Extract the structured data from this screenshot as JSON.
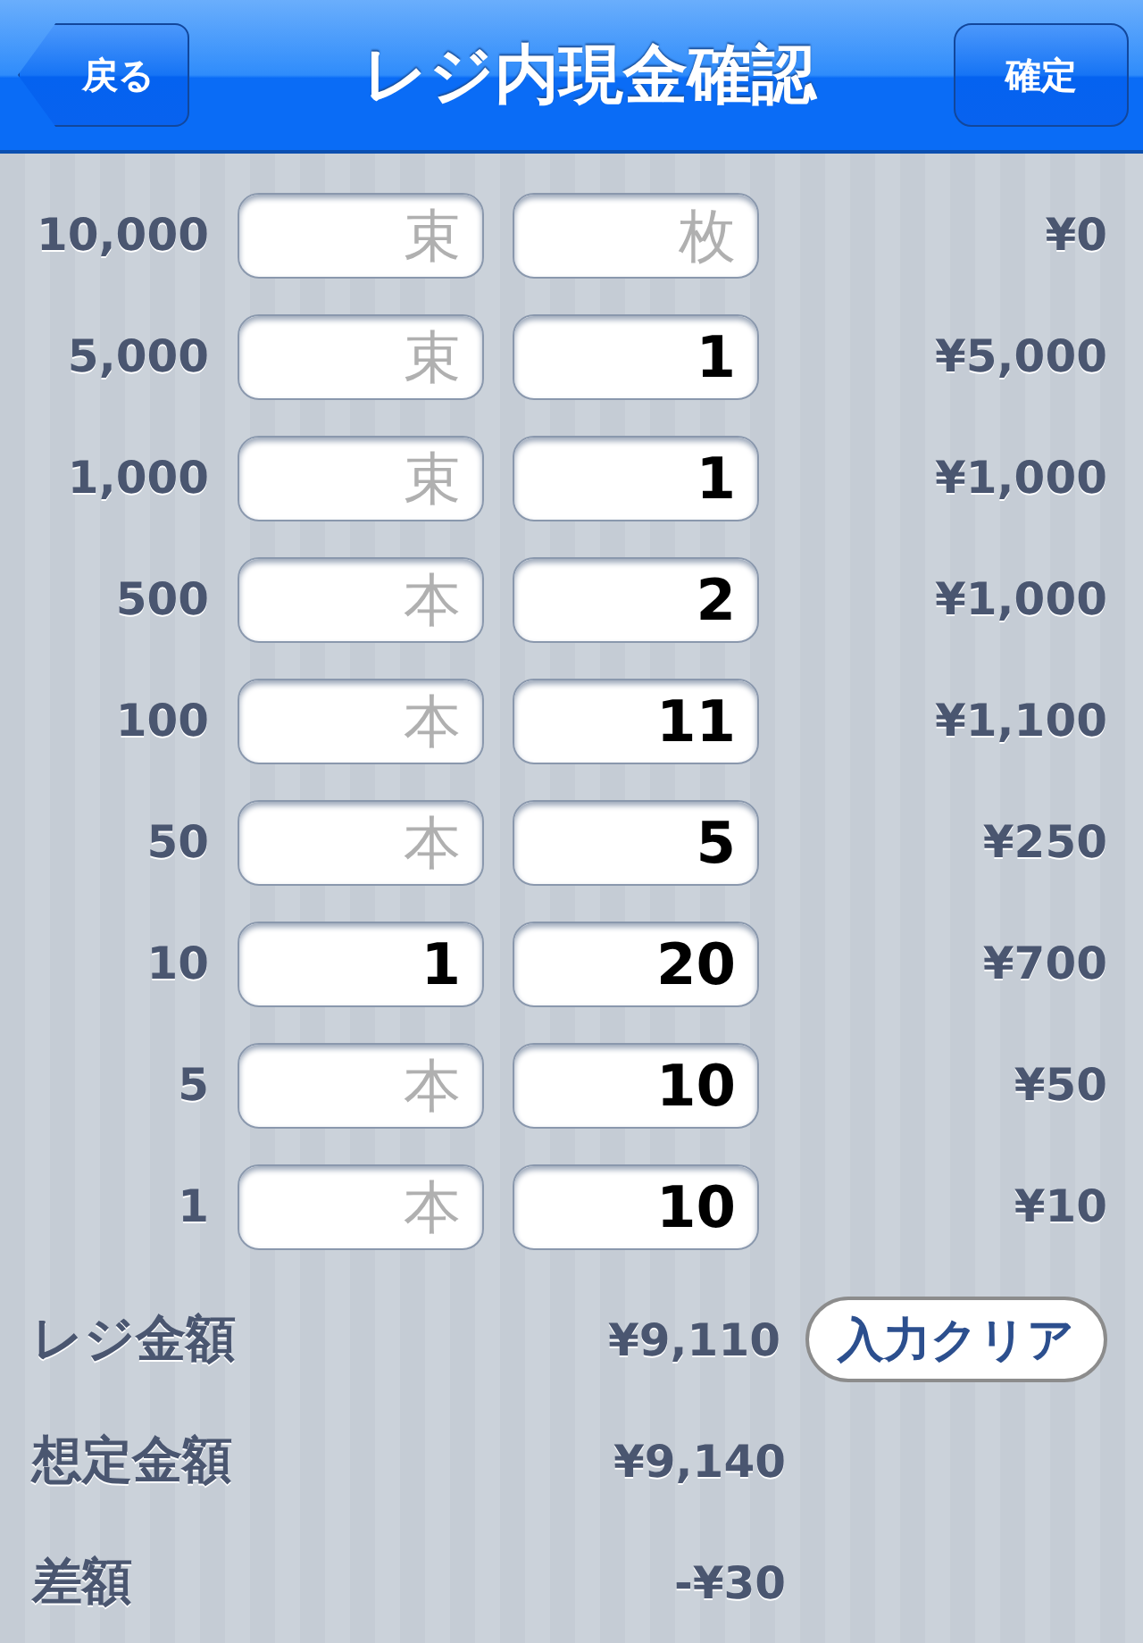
{
  "nav_bar": {
    "back_button": "戻る",
    "title": "レジ内現金確認",
    "confirm_button": "確定"
  },
  "rows": [
    {
      "denomination": "10,000",
      "bundle": {
        "placeholder": "束"
      },
      "count": {
        "placeholder": "枚"
      },
      "amount": "¥0"
    },
    {
      "denomination": "5,000",
      "bundle": {
        "placeholder": "束"
      },
      "count": {
        "value": "1"
      },
      "amount": "¥5,000"
    },
    {
      "denomination": "1,000",
      "bundle": {
        "placeholder": "束"
      },
      "count": {
        "value": "1"
      },
      "amount": "¥1,000"
    },
    {
      "denomination": "500",
      "bundle": {
        "placeholder": "本"
      },
      "count": {
        "value": "2"
      },
      "amount": "¥1,000"
    },
    {
      "denomination": "100",
      "bundle": {
        "placeholder": "本"
      },
      "count": {
        "value": "11"
      },
      "amount": "¥1,100"
    },
    {
      "denomination": "50",
      "bundle": {
        "placeholder": "本"
      },
      "count": {
        "value": "5"
      },
      "amount": "¥250"
    },
    {
      "denomination": "10",
      "bundle": {
        "value": "1"
      },
      "count": {
        "value": "20"
      },
      "amount": "¥700"
    },
    {
      "denomination": "5",
      "bundle": {
        "placeholder": "本"
      },
      "count": {
        "value": "10"
      },
      "amount": "¥50"
    },
    {
      "denomination": "1",
      "bundle": {
        "placeholder": "本"
      },
      "count": {
        "value": "10"
      },
      "amount": "¥10"
    }
  ],
  "summary": [
    {
      "label": "レジ金額",
      "value": "¥9,110"
    },
    {
      "label": "想定金額",
      "value": "¥9,140"
    },
    {
      "label": "差額",
      "value": "-¥30"
    }
  ],
  "clear_button": "入力クリア"
}
